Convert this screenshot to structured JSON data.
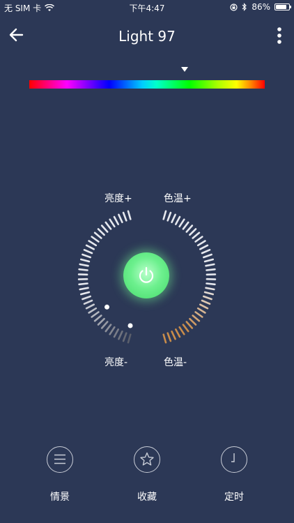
{
  "status_bar": {
    "carrier": "无 SIM 卡",
    "time": "下午4:47",
    "battery_text": "86%",
    "battery_level": 0.86,
    "icons": [
      "wifi-icon",
      "orientation-lock-icon",
      "bluetooth-icon",
      "battery-icon"
    ]
  },
  "header": {
    "title": "Light 97",
    "back_icon": "arrow-left-icon",
    "more_icon": "more-vertical-icon"
  },
  "color_spectrum": {
    "indicator_position": 0.66
  },
  "brightness_dial": {
    "label_plus": "亮度+",
    "label_minus": "亮度-",
    "level": 0.25
  },
  "temperature_dial": {
    "label_plus": "色温+",
    "label_minus": "色温-",
    "level": 0.0,
    "warm_color": "#c98c4a"
  },
  "power": {
    "icon": "power-icon",
    "state_color": "#5fe882"
  },
  "bottom_bar": {
    "items": [
      {
        "label": "情景",
        "icon": "menu-lines-icon"
      },
      {
        "label": "收藏",
        "icon": "star-icon"
      },
      {
        "label": "定时",
        "icon": "clock-icon"
      }
    ]
  },
  "colors": {
    "background": "#2c3856",
    "tick_white": "#e6e8ee",
    "tick_dim": "#5b5f6b"
  }
}
